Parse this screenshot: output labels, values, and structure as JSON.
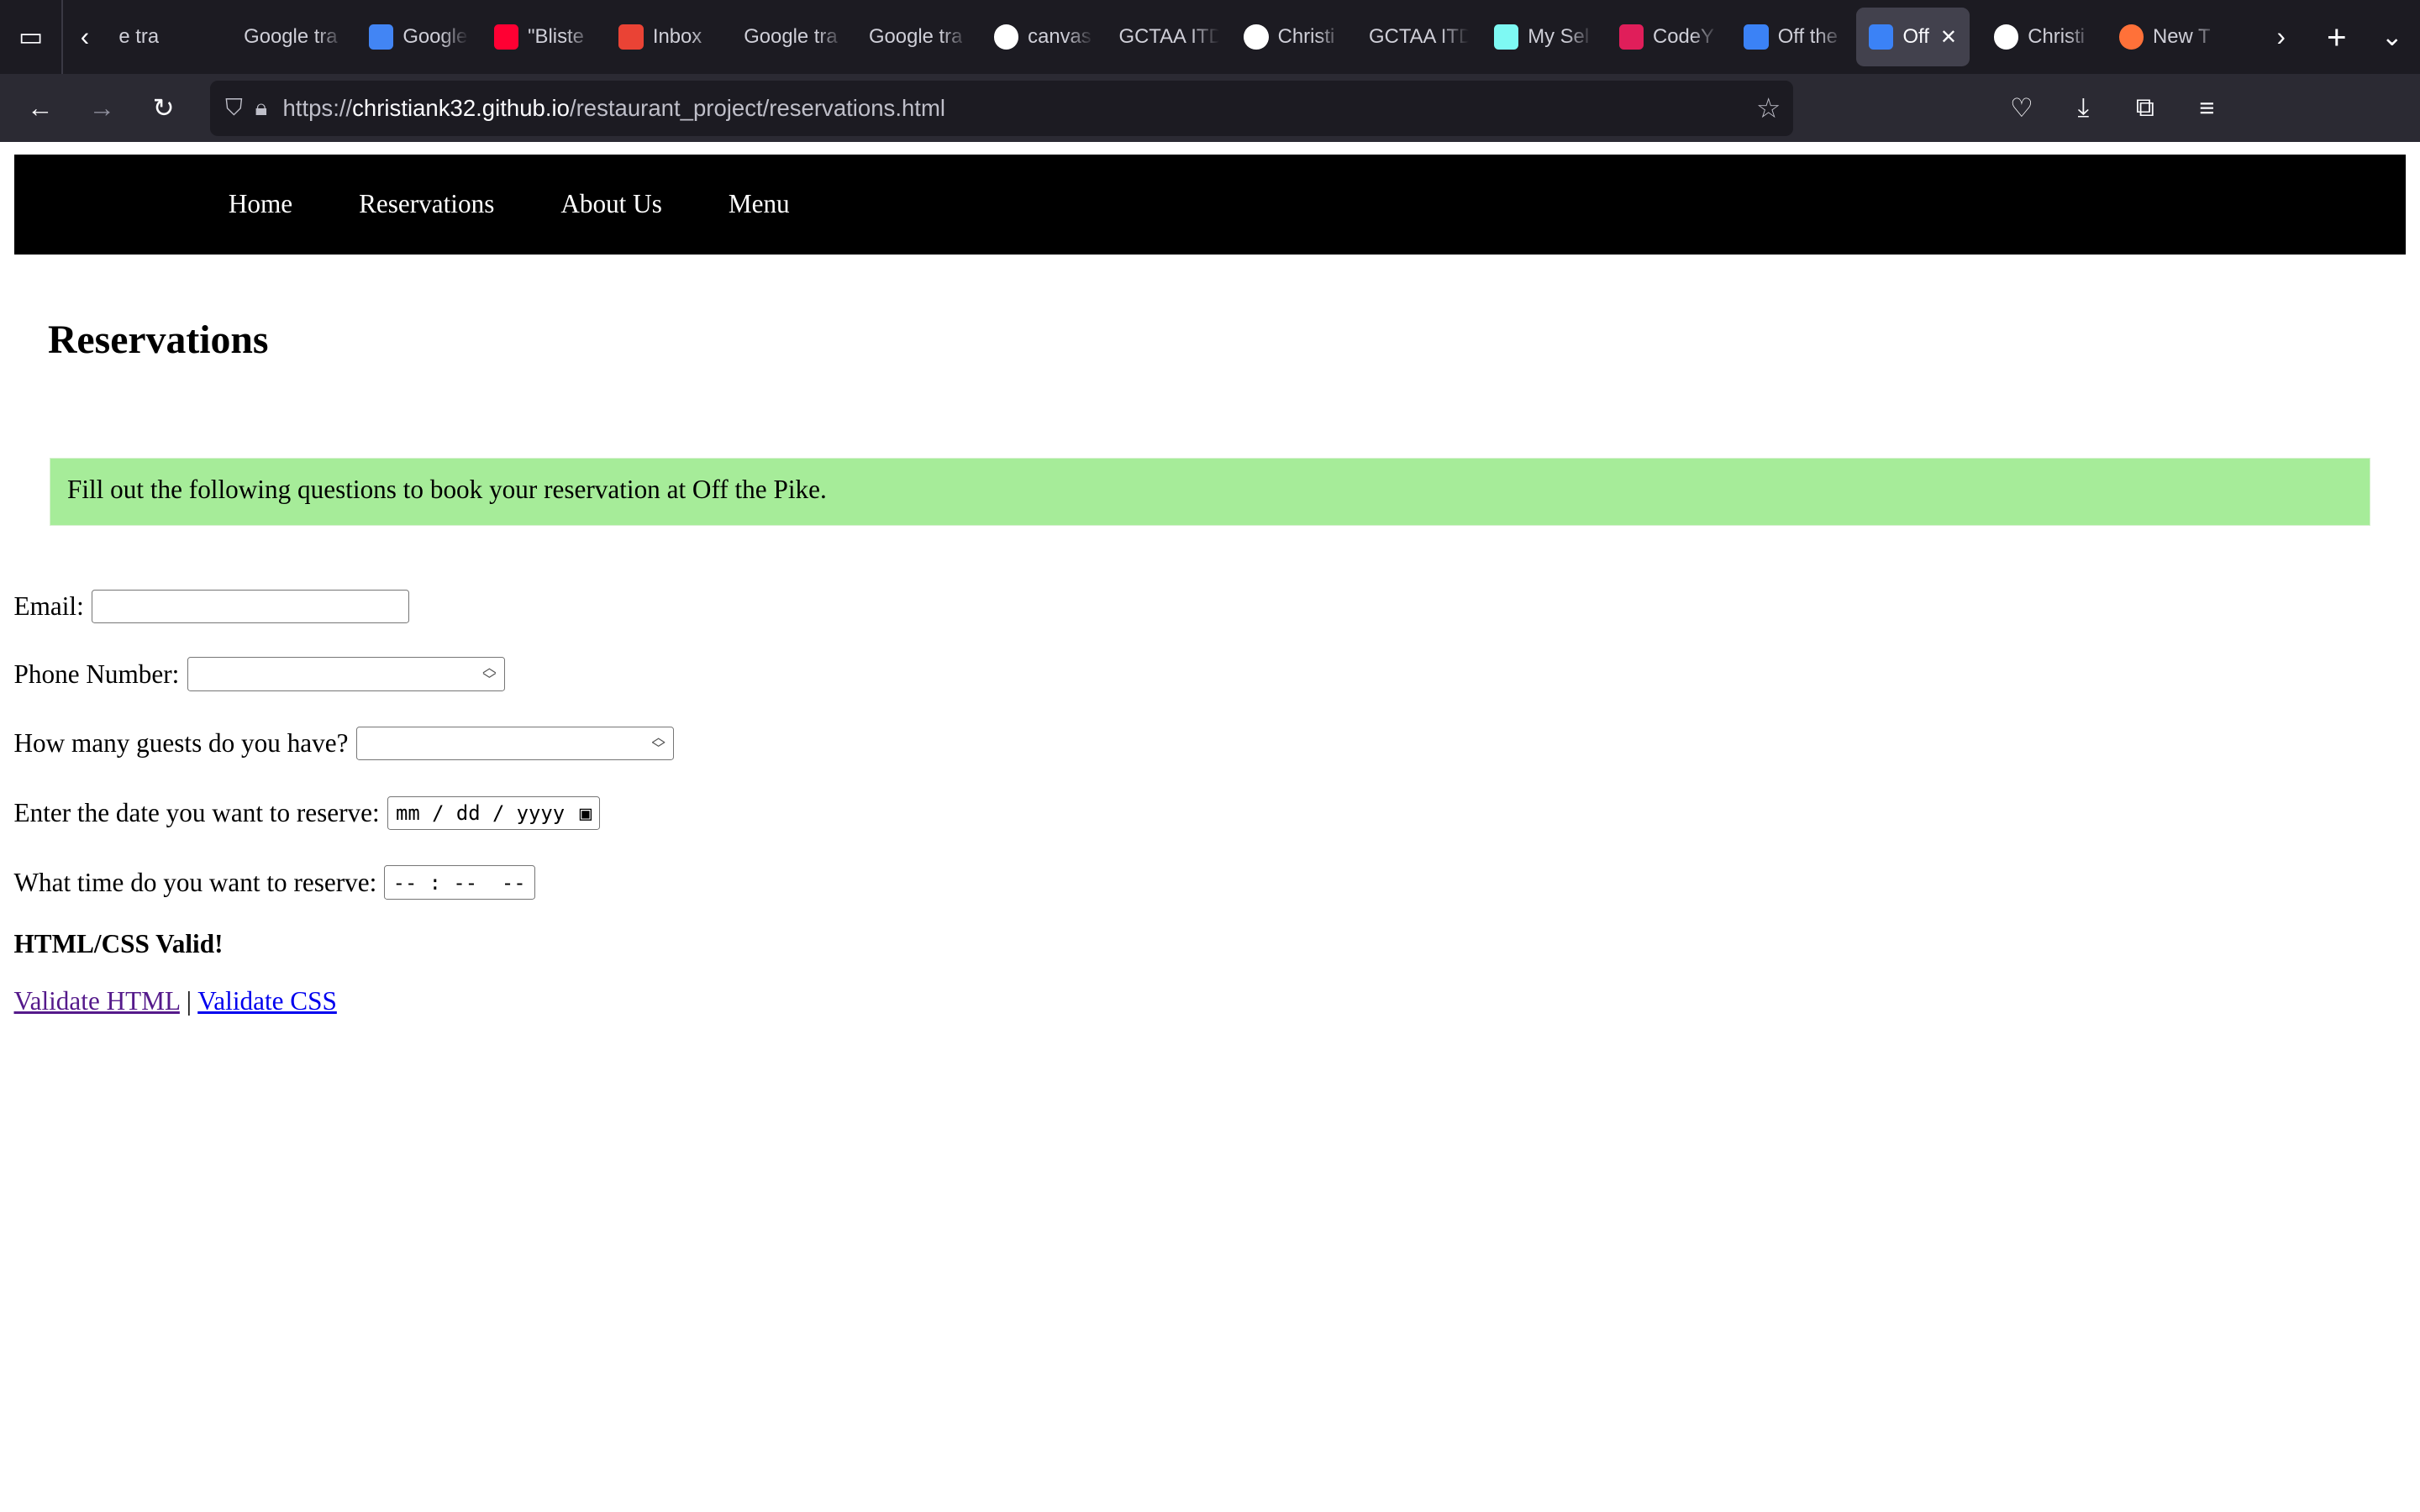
{
  "browser": {
    "tabs": [
      {
        "label": "e tra",
        "favicon": "none"
      },
      {
        "label": "Google tra",
        "favicon": "none"
      },
      {
        "label": "Google",
        "favicon": "google-translate",
        "color": "#4285f4"
      },
      {
        "label": "\"Bliste",
        "favicon": "youtube",
        "color": "#ff0033"
      },
      {
        "label": "Inbox",
        "favicon": "gmail",
        "color": "#ea4335"
      },
      {
        "label": "Google tra",
        "favicon": "none"
      },
      {
        "label": "Google tra",
        "favicon": "none"
      },
      {
        "label": "canvas",
        "favicon": "google",
        "color": "#ffffff"
      },
      {
        "label": "GCTAA ITD",
        "favicon": "none"
      },
      {
        "label": "Christi",
        "favicon": "github",
        "color": "#ffffff"
      },
      {
        "label": "GCTAA ITD",
        "favicon": "none"
      },
      {
        "label": "My Sel",
        "favicon": "pixel-art",
        "color": "#7ef9f3"
      },
      {
        "label": "CodeY",
        "favicon": "slack",
        "color": "#e01e5a"
      },
      {
        "label": "Off the",
        "favicon": "ck-logo",
        "color": "#3b82f6"
      },
      {
        "label": "Off",
        "favicon": "ck-logo",
        "color": "#3b82f6",
        "active": true
      },
      {
        "label": "Christi",
        "favicon": "github",
        "color": "#ffffff"
      },
      {
        "label": "New T",
        "favicon": "firefox",
        "color": "#ff7139"
      }
    ],
    "url_host": "christiank32.github.io",
    "url_prefix": "https://",
    "url_path": "/restaurant_project/reservations.html"
  },
  "nav": {
    "items": [
      "Home",
      "Reservations",
      "About Us",
      "Menu"
    ]
  },
  "page": {
    "title": "Reservations",
    "notice": "Fill out the following questions to book your reservation at Off the Pike.",
    "notice_color": "#a6ec99",
    "fields": {
      "email_label": "Email:",
      "phone_label": "Phone Number:",
      "guests_label": "How many guests do you have?",
      "date_label": "Enter the date you want to reserve:",
      "date_placeholder": "mm / dd / yyyy",
      "time_label": "What time do you want to reserve:",
      "time_placeholder": "-- : --  --"
    },
    "valid_heading": "HTML/CSS Valid!",
    "link_html": "Validate HTML",
    "link_sep": "|",
    "link_css": "Validate CSS"
  }
}
